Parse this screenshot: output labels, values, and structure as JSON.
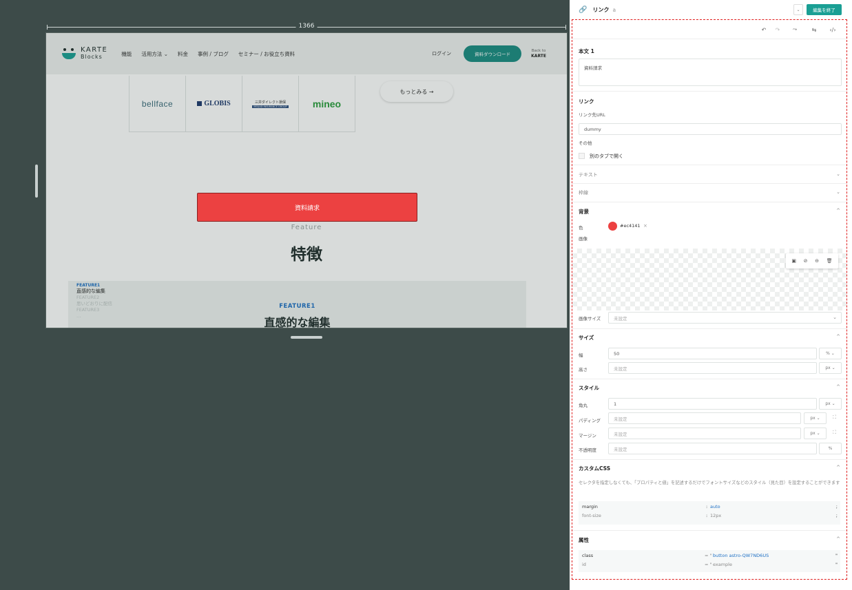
{
  "canvas": {
    "width_label": "1366",
    "site": {
      "logo_main": "KARTE",
      "logo_sub": "Blocks",
      "nav_items": [
        "機能",
        "活用方法 ⌄",
        "料金",
        "事例 / ブログ",
        "セミナー / お役立ち資料"
      ],
      "login": "ログイン",
      "download": "資料ダウンロード",
      "back_line1": "Back to",
      "back_line2": "KARTE",
      "logos": [
        "bellface",
        "GLOBIS",
        "三井ダイレクト損保",
        "mineo"
      ],
      "sanyo_sub": "MS&AD INSURANCE GROUP",
      "more": "もっとみる →",
      "button_text": "資料請求",
      "feature_en": "Feature",
      "feature_jp": "特徴",
      "feature_list": [
        {
          "key": "FEATURE1",
          "value": "直感的な編集",
          "active": true
        },
        {
          "key": "FEATURE2",
          "value": "思いどおりに配信",
          "active": false
        },
        {
          "key": "FEATURE3",
          "value": "…",
          "active": false
        }
      ],
      "feature_center_key": "FEATURE1",
      "feature_center_value": "直感的な編集"
    }
  },
  "panel": {
    "header": {
      "link_icon": "🔗",
      "title": "リンク",
      "tag": "a",
      "dropdown": "⌄",
      "done_button": "編集を終了"
    },
    "toolbar_icons": [
      "↶",
      "↷",
      "⤳",
      "⇆",
      "‹/›"
    ],
    "body": {
      "section_title": "本文 1",
      "text_value": "資料請求"
    },
    "link": {
      "section_title": "リンク",
      "url_label": "リンク先URL",
      "url_value": "dummy",
      "other_label": "その他",
      "new_tab_label": "別のタブで開く"
    },
    "text_section": "テキスト",
    "border_section": "枠線",
    "background": {
      "section_title": "背景",
      "color_label": "色",
      "color_value": "#ec4141",
      "clear": "×",
      "image_label": "画像",
      "image_tools": [
        "▣",
        "⊘",
        "⊖",
        "🗑"
      ],
      "image_size_label": "画像サイズ",
      "image_size_value": "未設定"
    },
    "size": {
      "section_title": "サイズ",
      "width_label": "幅",
      "width_value": "50",
      "width_unit": "% ⌄",
      "height_label": "高さ",
      "height_value": "未設定",
      "height_unit": "px ⌄"
    },
    "style": {
      "section_title": "スタイル",
      "radius_label": "角丸",
      "radius_value": "1",
      "radius_unit": "px ⌄",
      "padding_label": "パディング",
      "padding_value": "未設定",
      "padding_unit": "px ⌄",
      "margin_label": "マージン",
      "margin_value": "未設定",
      "margin_unit": "px ⌄",
      "opacity_label": "不透明度",
      "opacity_value": "未設定",
      "opacity_unit": "%"
    },
    "custom_css": {
      "section_title": "カスタムCSS",
      "help": "セレクタを指定しなくても、「プロパティと値」を記述するだけでフォントサイズなどのスタイル（見た目）を設定することができます",
      "rows": [
        {
          "prop": "margin",
          "value": "auto"
        },
        {
          "prop": "font-size",
          "value": "12px"
        }
      ]
    },
    "attributes": {
      "section_title": "属性",
      "rows": [
        {
          "name": "class",
          "value": "button astro-QW7ND6US"
        },
        {
          "name": "id",
          "value": "example"
        }
      ]
    },
    "chevron_up": "^",
    "chevron_down": "⌄"
  },
  "colors": {
    "accent": "#1a9f94",
    "button_red": "#ec4141",
    "selection_outline": "#e01d1d",
    "canvas_bg": "#3d4b49"
  }
}
